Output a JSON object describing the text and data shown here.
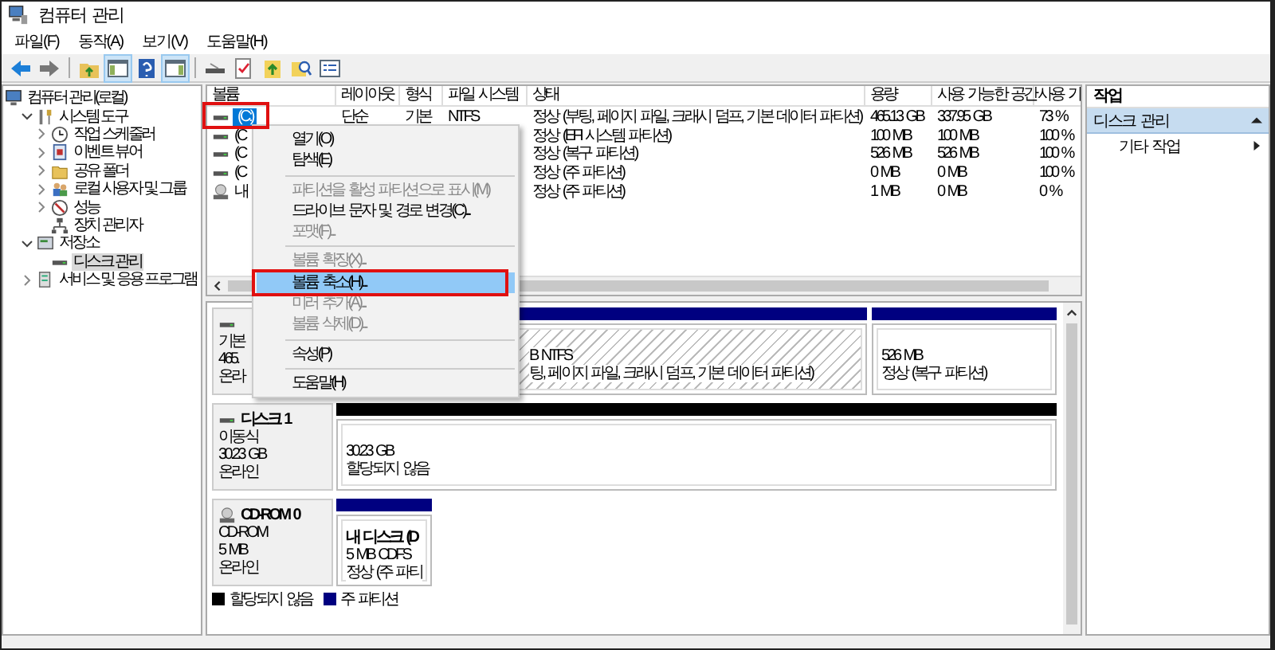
{
  "window": {
    "title": "컴퓨터 관리"
  },
  "menu_bar": [
    {
      "label": "파일(F)"
    },
    {
      "label": "동작(A)"
    },
    {
      "label": "보기(V)"
    },
    {
      "label": "도움말(H)"
    }
  ],
  "toolbar": [
    {
      "kind": "back",
      "pressed": false
    },
    {
      "kind": "forward",
      "pressed": false
    },
    {
      "kind": "sep"
    },
    {
      "kind": "up",
      "pressed": false
    },
    {
      "kind": "tree",
      "pressed": true
    },
    {
      "kind": "help",
      "pressed": false
    },
    {
      "kind": "pane",
      "pressed": true
    },
    {
      "kind": "sep"
    },
    {
      "kind": "drive",
      "pressed": false
    },
    {
      "kind": "check",
      "pressed": false
    },
    {
      "kind": "arrowup",
      "pressed": false
    },
    {
      "kind": "find",
      "pressed": false
    },
    {
      "kind": "list",
      "pressed": false
    }
  ],
  "tree": [
    {
      "label": "컴퓨터 관리(로컬)",
      "kind": "computer",
      "selected": false,
      "children": [
        {
          "label": "시스템 도구",
          "kind": "tools",
          "expandable": true,
          "expanded": true,
          "selected": false,
          "children": [
            {
              "label": "작업 스케줄러",
              "kind": "clock",
              "expandable": true,
              "expanded": false,
              "selected": false
            },
            {
              "label": "이벤트 뷰어",
              "kind": "event",
              "expandable": true,
              "expanded": false,
              "selected": false
            },
            {
              "label": "공유 폴더",
              "kind": "folder",
              "expandable": true,
              "expanded": false,
              "selected": false
            },
            {
              "label": "로컬 사용자 및 그룹",
              "kind": "users",
              "expandable": true,
              "expanded": false,
              "selected": false
            },
            {
              "label": "성능",
              "kind": "gauge",
              "expandable": true,
              "expanded": false,
              "selected": false
            },
            {
              "label": "장치 관리자",
              "kind": "device",
              "expandable": false,
              "selected": false
            }
          ]
        },
        {
          "label": "저장소",
          "kind": "storage",
          "expandable": true,
          "expanded": true,
          "selected": false,
          "children": [
            {
              "label": "디스크 관리",
              "kind": "disk",
              "expandable": false,
              "selected": true
            }
          ]
        },
        {
          "label": "서비스 및 응용 프로그램",
          "kind": "services",
          "expandable": true,
          "expanded": false,
          "selected": false
        }
      ]
    }
  ],
  "volume_table": {
    "columns": [
      "볼륨",
      "레이아웃",
      "형식",
      "파일 시스템",
      "상태",
      "용량",
      "사용 가능한 공간",
      "사용 가"
    ],
    "rows": [
      {
        "kind": "disk",
        "selected": true,
        "cells": [
          "(C:)",
          "단순",
          "기본",
          "NTFS",
          "정상 (부팅, 페이지 파일, 크래시 덤프, 기본 데이터 파티션)",
          "465.13 GB",
          "337.95 GB",
          "73 %"
        ]
      },
      {
        "kind": "disk",
        "selected": false,
        "cells": [
          "(C",
          null,
          null,
          null,
          "정상 (EFI 시스템 파티션)",
          "100 MB",
          "100 MB",
          "100 %"
        ]
      },
      {
        "kind": "disk",
        "selected": false,
        "cells": [
          "(C",
          null,
          null,
          null,
          "정상 (복구 파티션)",
          "526 MB",
          "526 MB",
          "100 %"
        ]
      },
      {
        "kind": "disk",
        "selected": false,
        "cells": [
          "(C",
          null,
          null,
          null,
          "정상 (주 파티션)",
          "0 MB",
          "0 MB",
          "100 %"
        ]
      },
      {
        "kind": "cd",
        "selected": false,
        "cells": [
          "내",
          null,
          null,
          null,
          "정상 (주 파티션)",
          "1 MB",
          "0 MB",
          "0 %"
        ]
      }
    ]
  },
  "disks": [
    {
      "kind": "disk",
      "info": [
        "기본",
        "465.",
        "온라"
      ],
      "partitions": [
        {
          "kind": "primary",
          "hatched": true,
          "lines": [
            "B NTFS",
            "팅, 페이지 파일, 크래시 덤프, 기본 데이터 파티션)"
          ]
        },
        {
          "kind": "primary",
          "hatched": false,
          "lines": [
            "526 MB",
            "정상 (복구 파티션)"
          ]
        }
      ]
    },
    {
      "kind": "disk",
      "name": "디스크 1",
      "info": [
        "이동식",
        "30.23 GB",
        "온라인"
      ],
      "partitions": [
        {
          "kind": "unallocated",
          "hatched": false,
          "lines": [
            "30.23 GB",
            "할당되지 않음"
          ]
        }
      ]
    },
    {
      "kind": "cd",
      "name": "CD-ROM 0",
      "info": [
        "CD-ROM",
        "5 MB",
        "온라인"
      ],
      "partitions": [
        {
          "kind": "primary",
          "hatched": false,
          "title": "내 디스크  (D",
          "lines": [
            "5 MB CDFS",
            "정상 (주 파티"
          ]
        }
      ]
    }
  ],
  "legend": [
    {
      "label": "할당되지 않음",
      "color": "#000000"
    },
    {
      "label": "주 파티션",
      "color": "#000080"
    }
  ],
  "context_menu": [
    {
      "kind": "item",
      "label": "열기(O)",
      "disabled": false,
      "selected": false
    },
    {
      "kind": "item",
      "label": "탐색(E)",
      "disabled": false,
      "selected": false
    },
    {
      "kind": "separator"
    },
    {
      "kind": "item",
      "label": "파티션을 활성 파티션으로 표시(M)",
      "disabled": true,
      "selected": false
    },
    {
      "kind": "item",
      "label": "드라이브 문자 및 경로 변경(C)...",
      "disabled": false,
      "selected": false
    },
    {
      "kind": "item",
      "label": "포맷(F)...",
      "disabled": true,
      "selected": false
    },
    {
      "kind": "separator"
    },
    {
      "kind": "item",
      "label": "볼륨 확장(X)...",
      "disabled": true,
      "selected": false
    },
    {
      "kind": "item",
      "label": "볼륨 축소(H)...",
      "disabled": false,
      "selected": true
    },
    {
      "kind": "item",
      "label": "미러 추가(A)...",
      "disabled": true,
      "selected": false
    },
    {
      "kind": "item",
      "label": "볼륨 삭제(D)...",
      "disabled": true,
      "selected": false
    },
    {
      "kind": "separator"
    },
    {
      "kind": "item",
      "label": "속성(P)",
      "disabled": false,
      "selected": false
    },
    {
      "kind": "separator"
    },
    {
      "kind": "item",
      "label": "도움말(H)",
      "disabled": false,
      "selected": false
    }
  ],
  "actions": {
    "title": "작업",
    "section": {
      "label": "디스크 관리",
      "expanded": true
    },
    "items": [
      {
        "label": "기타 작업"
      }
    ]
  }
}
